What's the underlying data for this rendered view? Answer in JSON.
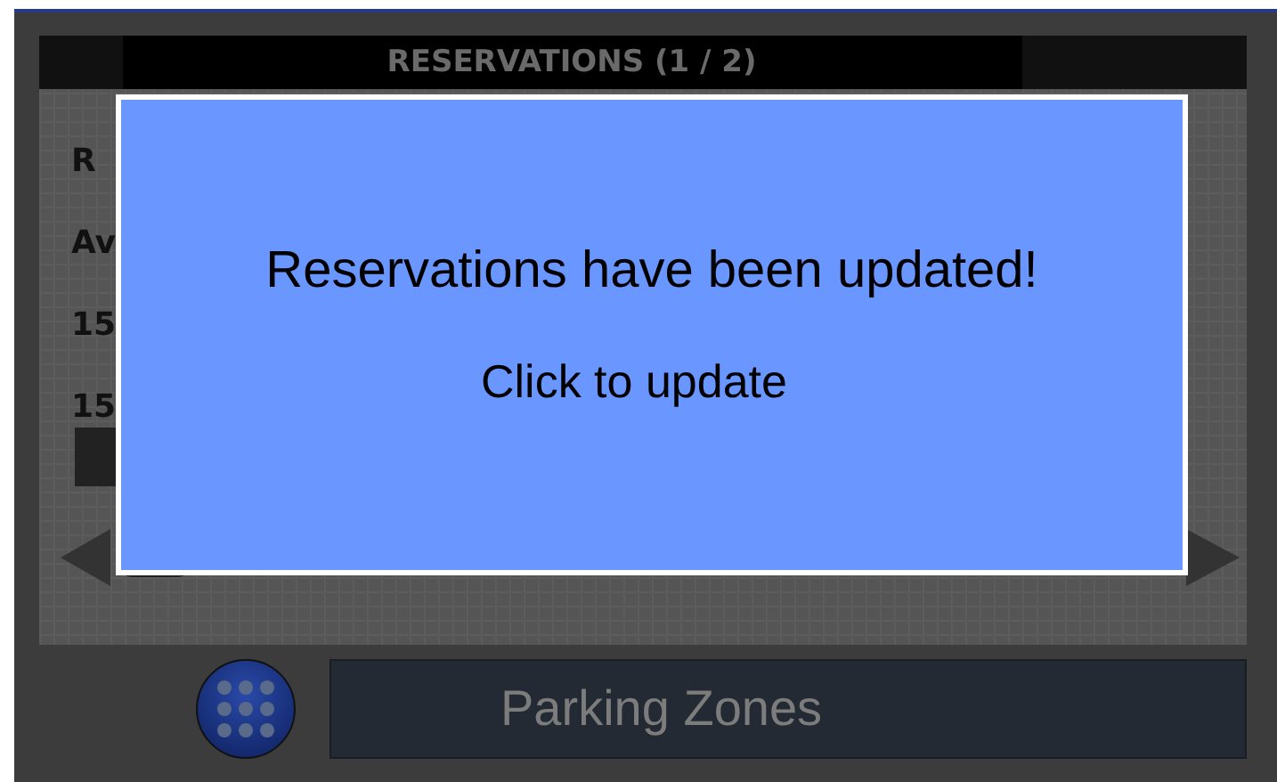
{
  "panel": {
    "title": "RESERVATIONS (1 / 2)",
    "lines": [
      "R",
      "Av",
      "15",
      "15"
    ]
  },
  "dialog": {
    "message": "Reservations have been updated!",
    "action": "Click to update"
  },
  "bottom_bar": {
    "label": "Parking Zones"
  }
}
